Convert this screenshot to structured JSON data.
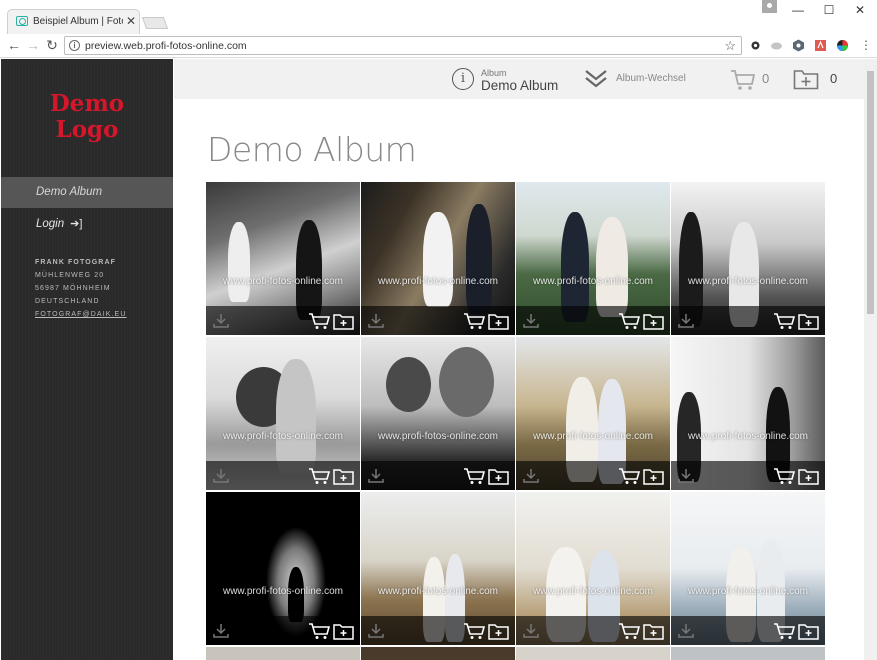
{
  "browser": {
    "tab_title": "Beispiel Album | Fotogra",
    "url": "preview.web.profi-fotos-online.com"
  },
  "sidebar": {
    "logo_line1": "Demo",
    "logo_line2": "Logo",
    "nav_active": "Demo Album",
    "login_label": "Login",
    "address": {
      "name": "FRANK FOTOGRAF",
      "street": "MÜHLENWEG 20",
      "city": "56987 MÖHNHEIM",
      "country": "DEUTSCHLAND",
      "email": "FOTOGRAF@DAIK.EU"
    }
  },
  "topbar": {
    "album_small": "Album",
    "album_name": "Demo Album",
    "switch_label": "Album-Wechsel",
    "cart_count": "0",
    "folder_count": "0"
  },
  "main": {
    "title": "Demo Album",
    "watermark": "www.profi-fotos-online.com"
  },
  "colors": {
    "logo": "#d6162b",
    "sidebar_bg": "#2a2a2a",
    "topbar_bg": "#f1f1f1"
  }
}
